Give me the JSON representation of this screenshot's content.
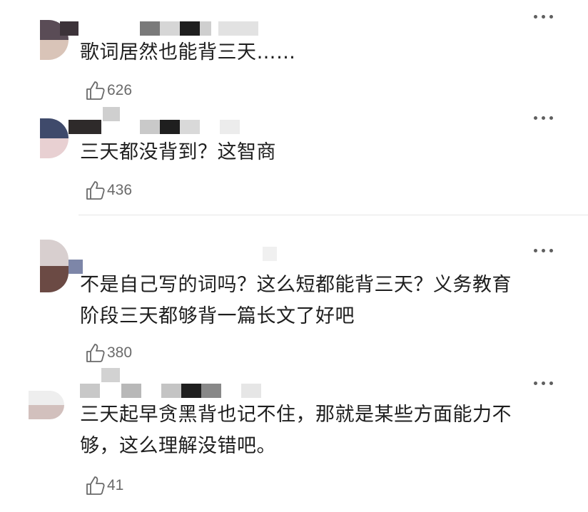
{
  "comments": [
    {
      "text": "歌词居然也能背三天……",
      "likes": "626",
      "icon": "thumbs-up-icon",
      "more_icon": "more-icon"
    },
    {
      "text": "三天都没背到？这智商",
      "likes": "436",
      "icon": "thumbs-up-icon",
      "more_icon": "more-icon"
    },
    {
      "text": "不是自己写的词吗？这么短都能背三天？义务教育\n阶段三天都够背一篇长文了好吧",
      "likes": "380",
      "icon": "thumbs-up-icon",
      "more_icon": "more-icon"
    },
    {
      "text": "三天起早贪黑背也记不住，那就是某些方面能力不\n够，这么理解没错吧。",
      "likes": "41",
      "icon": "thumbs-up-icon",
      "more_icon": "more-icon"
    }
  ],
  "colors": {
    "text": "#1e1e1e",
    "count": "#6a6a6a",
    "divider": "#e6e6e6"
  }
}
